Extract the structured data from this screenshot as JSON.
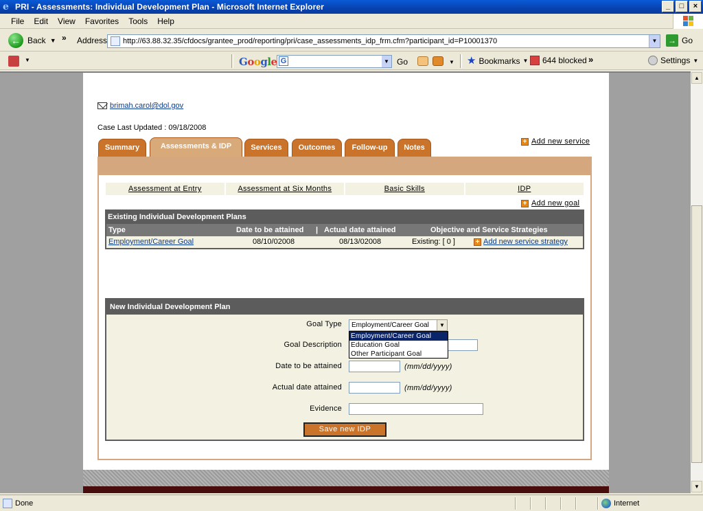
{
  "window": {
    "title": "PRI - Assessments: Individual Development Plan - Microsoft Internet Explorer"
  },
  "menu": {
    "items": [
      "File",
      "Edit",
      "View",
      "Favorites",
      "Tools",
      "Help"
    ]
  },
  "addressbar": {
    "back_label": "Back",
    "address_label": "Address",
    "url": "http://63.88.32.35/cfdocs/grantee_prod/reporting/pri/case_assessments_idp_frm.cfm?participant_id=P10001370",
    "go_label": "Go"
  },
  "googlebar": {
    "logo": "Google",
    "go_label": "Go",
    "bookmarks_label": "Bookmarks",
    "blocked_label": "644 blocked",
    "settings_label": "Settings"
  },
  "page": {
    "email": "brimah.carol@dol.gov",
    "case_updated": "Case Last Updated : 09/18/2008",
    "tabs": [
      {
        "label": "Summary"
      },
      {
        "label": "Assessments & IDP"
      },
      {
        "label": "Services"
      },
      {
        "label": "Outcomes"
      },
      {
        "label": "Follow-up"
      },
      {
        "label": "Notes"
      }
    ],
    "add_service": "Add new service",
    "subnav": [
      "Assessment at Entry",
      "Assessment at Six Months",
      "Basic Skills",
      "IDP"
    ],
    "add_goal": "Add new goal",
    "existing": {
      "title": "Existing Individual Development Plans",
      "columns": {
        "type": "Type",
        "date_to_be": "Date to be attained",
        "sep": "|",
        "actual_date": "Actual date attained",
        "objective": "Objective and Service Strategies"
      },
      "rows": [
        {
          "type": "Employment/Career Goal",
          "date_to_be": "08/10/02008",
          "actual_date": "08/13/02008",
          "existing": "Existing: [ 0 ]",
          "add_strategy": "Add new service strategy"
        }
      ]
    },
    "newplan": {
      "title": "New Individual Development Plan",
      "goal_type_label": "Goal Type",
      "goal_type_value": "Employment/Career Goal",
      "goal_type_options": [
        "Employment/Career Goal",
        "Education Goal",
        "Other Participant Goal"
      ],
      "goal_desc_label": "Goal Description",
      "date_to_be_label": "Date to be attained",
      "actual_date_label": "Actual date attained",
      "date_hint": "(mm/dd/yyyy)",
      "evidence_label": "Evidence",
      "save_label": "Save new IDP"
    }
  },
  "status": {
    "text": "Done",
    "zone": "Internet"
  },
  "colors": {
    "tab_orange": "#c9742a",
    "tab_active": "#d8a979",
    "panel_border": "#d4a77e",
    "header_gray": "#5c5c5c",
    "row_bg": "#f3f2e2"
  }
}
